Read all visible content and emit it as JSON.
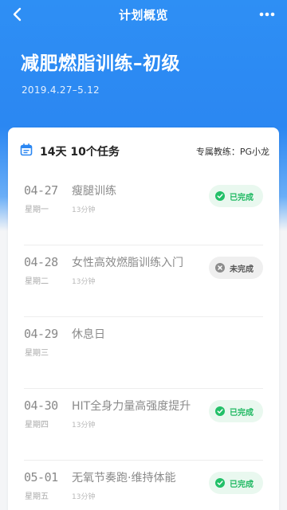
{
  "nav": {
    "title": "计划概览",
    "back_icon": "chevron-left-icon",
    "more_icon": "more-horizontal-icon"
  },
  "plan": {
    "title": "减肥燃脂训练–初级",
    "date_range": "2019.4.27–5.12"
  },
  "summary": {
    "text": "14天  10个任务",
    "coach_label": "专属教练：PG小龙",
    "icon": "calendar-icon"
  },
  "colors": {
    "primary": "#2b87f2",
    "done": "#22c068",
    "done_bg": "#e9f8ef",
    "todo": "#8c8c8c",
    "todo_bg": "#efefef"
  },
  "tasks": [
    {
      "date": "04-27",
      "weekday": "星期一",
      "title": "瘦腿训练",
      "duration": "13分钟",
      "status": "已完成",
      "state": "done"
    },
    {
      "date": "04-28",
      "weekday": "星期二",
      "title": "女性高效燃脂训练入门",
      "duration": "13分钟",
      "status": "未完成",
      "state": "todo"
    },
    {
      "date": "04-29",
      "weekday": "星期三",
      "title": "休息日",
      "duration": "",
      "status": "",
      "state": "rest"
    },
    {
      "date": "04-30",
      "weekday": "星期四",
      "title": "HIT全身力量高强度提升",
      "duration": "13分钟",
      "status": "已完成",
      "state": "done"
    },
    {
      "date": "05-01",
      "weekday": "星期五",
      "title": "无氧节奏跑·维持体能",
      "duration": "13分钟",
      "status": "已完成",
      "state": "done"
    }
  ]
}
